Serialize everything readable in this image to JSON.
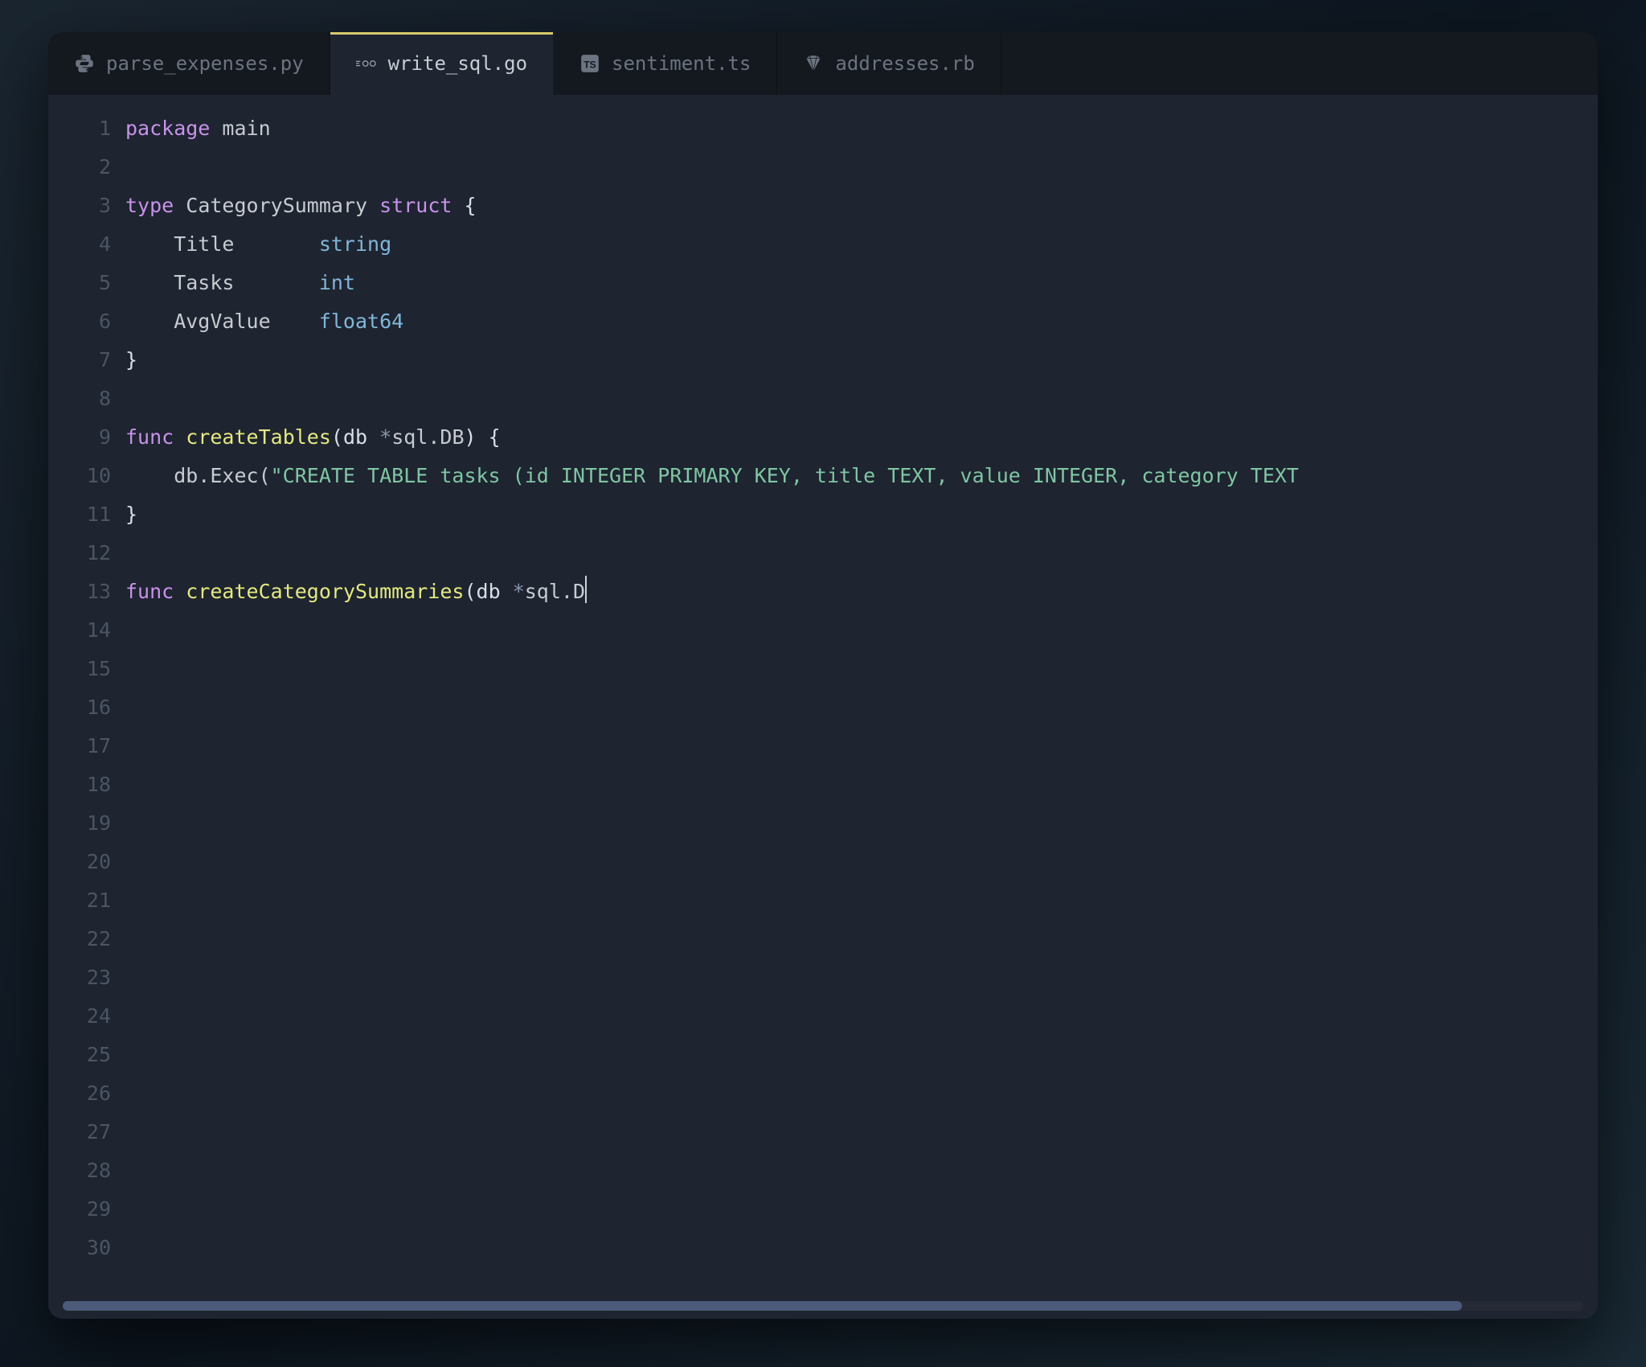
{
  "tabs": [
    {
      "label": "parse_expenses.py",
      "icon": "python-icon",
      "active": false
    },
    {
      "label": "write_sql.go",
      "icon": "go-icon",
      "active": true
    },
    {
      "label": "sentiment.ts",
      "icon": "typescript-icon",
      "active": false
    },
    {
      "label": "addresses.rb",
      "icon": "ruby-icon",
      "active": false
    }
  ],
  "line_count": 30,
  "code": {
    "lines": [
      [
        {
          "t": "package",
          "c": "kw"
        },
        {
          "t": " ",
          "c": "id"
        },
        {
          "t": "main",
          "c": "id"
        }
      ],
      [],
      [
        {
          "t": "type",
          "c": "kw"
        },
        {
          "t": " ",
          "c": "id"
        },
        {
          "t": "CategorySummary",
          "c": "id"
        },
        {
          "t": " ",
          "c": "id"
        },
        {
          "t": "struct",
          "c": "kw"
        },
        {
          "t": " {",
          "c": "pun"
        }
      ],
      [
        {
          "t": "    Title       ",
          "c": "id"
        },
        {
          "t": "string",
          "c": "type"
        }
      ],
      [
        {
          "t": "    Tasks       ",
          "c": "id"
        },
        {
          "t": "int",
          "c": "type"
        }
      ],
      [
        {
          "t": "    AvgValue    ",
          "c": "id"
        },
        {
          "t": "float64",
          "c": "type"
        }
      ],
      [
        {
          "t": "}",
          "c": "pun"
        }
      ],
      [],
      [
        {
          "t": "func",
          "c": "kw"
        },
        {
          "t": " ",
          "c": "id"
        },
        {
          "t": "createTables",
          "c": "fn"
        },
        {
          "t": "(db ",
          "c": "pun"
        },
        {
          "t": "*",
          "c": "op"
        },
        {
          "t": "sql.DB",
          "c": "id"
        },
        {
          "t": ") {",
          "c": "pun"
        }
      ],
      [
        {
          "t": "    db.Exec(",
          "c": "id"
        },
        {
          "t": "\"CREATE TABLE tasks (id INTEGER PRIMARY KEY, title TEXT, value INTEGER, category TEXT",
          "c": "str"
        }
      ],
      [
        {
          "t": "}",
          "c": "pun"
        }
      ],
      [],
      [
        {
          "t": "func",
          "c": "kw"
        },
        {
          "t": " ",
          "c": "id"
        },
        {
          "t": "createCategorySummaries",
          "c": "fn"
        },
        {
          "t": "(db ",
          "c": "pun"
        },
        {
          "t": "*",
          "c": "op"
        },
        {
          "t": "sql.D",
          "c": "id"
        },
        {
          "cursor": true
        }
      ],
      [],
      [],
      [],
      [],
      [],
      [],
      [],
      [],
      [],
      [],
      [],
      [],
      [],
      [],
      [],
      [],
      []
    ]
  },
  "colors": {
    "background": "#1e2430",
    "tabbar": "#14181f",
    "active_indicator": "#d9c96b",
    "keyword": "#c792ea",
    "type": "#7fb7d9",
    "func": "#e5e97d",
    "string": "#7fc6a2",
    "gutter": "#4b5563",
    "scroll_thumb": "#4a5a78"
  }
}
